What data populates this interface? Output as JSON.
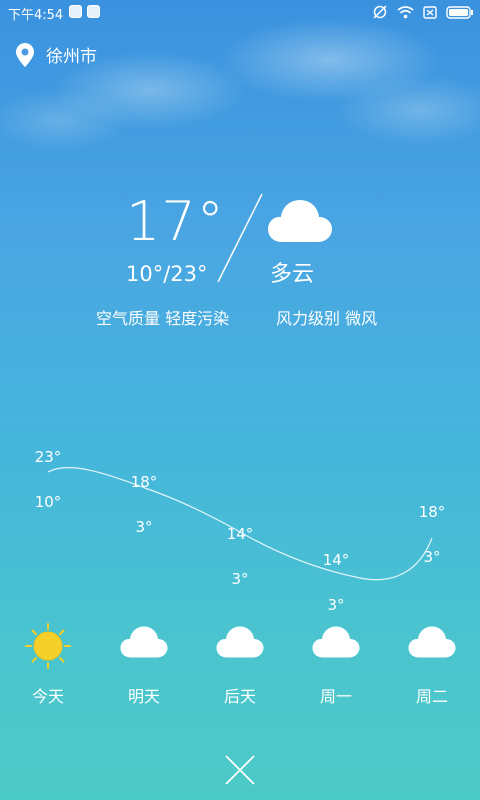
{
  "status_bar": {
    "time": "下午4:54",
    "icons": [
      "app-notification-icon",
      "app-notification-icon",
      "rotation-lock-icon",
      "wifi-icon",
      "no-sim-icon",
      "battery-icon"
    ]
  },
  "location": {
    "city": "徐州市",
    "icon": "location-pin-icon"
  },
  "current": {
    "temperature": "17°",
    "range": "10°/23°",
    "condition": "多云",
    "condition_icon": "cloud-icon",
    "air_quality": "空气质量 轻度污染",
    "wind": "风力级别 微风"
  },
  "forecast": {
    "days": [
      {
        "label": "今天",
        "high": "23°",
        "low": "10°",
        "icon": "sun-icon"
      },
      {
        "label": "明天",
        "high": "18°",
        "low": "3°",
        "icon": "cloud-icon"
      },
      {
        "label": "后天",
        "high": "14°",
        "low": "3°",
        "icon": "cloud-icon"
      },
      {
        "label": "周一",
        "high": "14°",
        "low": "3°",
        "icon": "cloud-icon"
      },
      {
        "label": "周二",
        "high": "18°",
        "low": "3°",
        "icon": "cloud-icon"
      }
    ]
  },
  "colors": {
    "sun": "#f5d02a",
    "text": "#ffffff"
  },
  "close_icon": "close-icon"
}
